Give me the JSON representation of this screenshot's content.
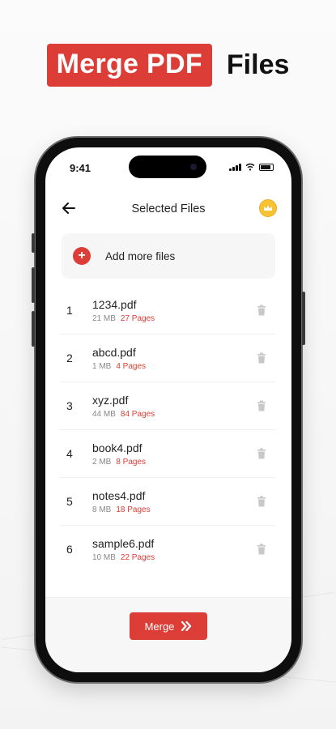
{
  "headline": {
    "badge": "Merge PDF",
    "plain": "Files"
  },
  "status_bar": {
    "time": "9:41"
  },
  "header": {
    "title": "Selected Files"
  },
  "add_files": {
    "label": "Add more files"
  },
  "files": [
    {
      "index": "1",
      "name": "1234.pdf",
      "size": "21 MB",
      "pages": "27 Pages"
    },
    {
      "index": "2",
      "name": "abcd.pdf",
      "size": "1 MB",
      "pages": "4 Pages"
    },
    {
      "index": "3",
      "name": "xyz.pdf",
      "size": "44 MB",
      "pages": "84 Pages"
    },
    {
      "index": "4",
      "name": "book4.pdf",
      "size": "2 MB",
      "pages": "8 Pages"
    },
    {
      "index": "5",
      "name": "notes4.pdf",
      "size": "8 MB",
      "pages": "18 Pages"
    },
    {
      "index": "6",
      "name": "sample6.pdf",
      "size": "10 MB",
      "pages": "22 Pages"
    }
  ],
  "merge_button": {
    "label": "Merge"
  },
  "colors": {
    "accent": "#dc3d36",
    "premium": "#f6c335"
  },
  "icons": {
    "back": "arrow-left-icon",
    "premium": "crown-icon",
    "add": "plus-icon",
    "delete": "trash-icon",
    "merge": "double-chevron-right-icon"
  }
}
